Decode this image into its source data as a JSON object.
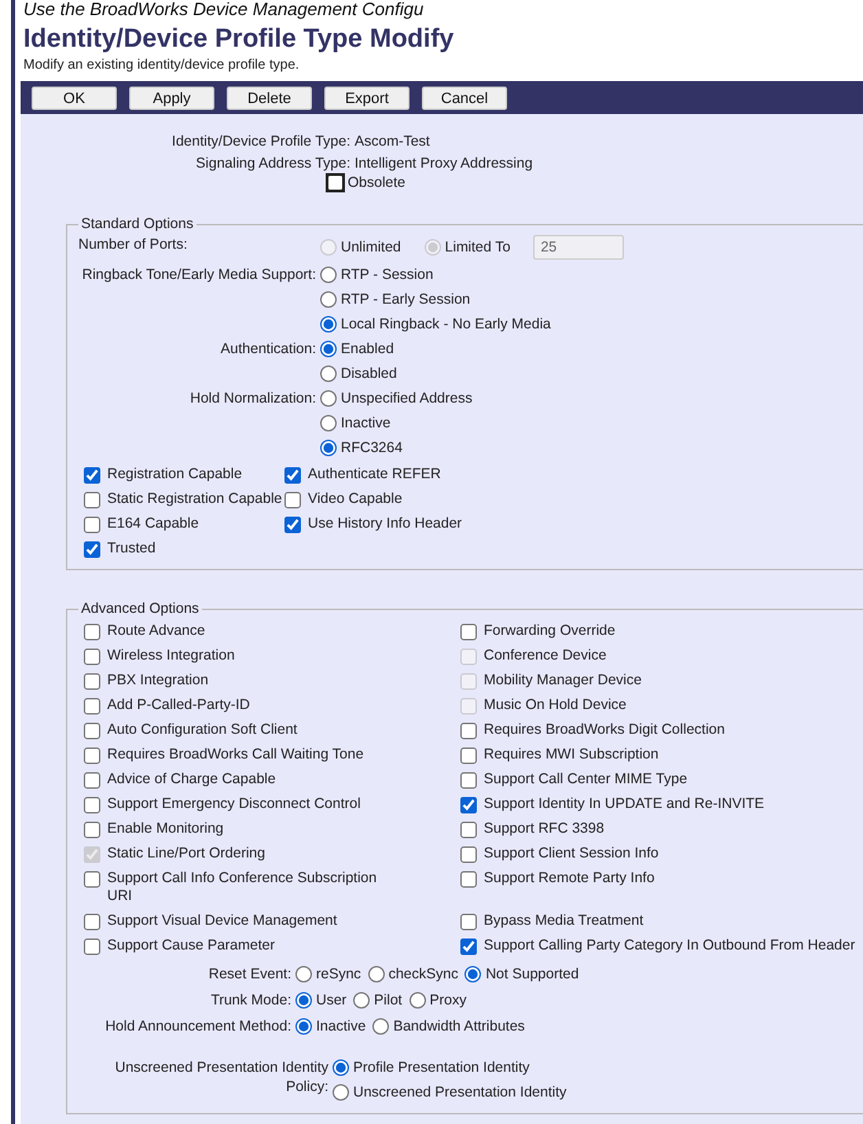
{
  "caption": "Use the BroadWorks Device Management Configu",
  "page": {
    "title": "Identity/Device Profile Type Modify",
    "subtitle": "Modify an existing identity/device profile type."
  },
  "buttons": [
    "OK",
    "Apply",
    "Delete",
    "Export",
    "Cancel"
  ],
  "info": [
    {
      "label": "Identity/Device Profile Type:",
      "value": "Ascom-Test"
    },
    {
      "label": "Signaling Address Type:",
      "value": "Intelligent Proxy Addressing"
    }
  ],
  "obsolete": {
    "label": "Obsolete",
    "checked": false
  },
  "standard_options": {
    "title": "Standard Options",
    "ports": {
      "label": "Number of Ports:",
      "options": [
        {
          "label": "Unlimited",
          "selected": false,
          "disabled": true
        },
        {
          "label": "Limited To",
          "selected": true,
          "disabled": true
        }
      ],
      "value": "25"
    },
    "radio_groups": [
      {
        "label": "Ringback Tone/Early Media Support:",
        "options": [
          {
            "label": "RTP - Session",
            "selected": false
          },
          {
            "label": "RTP - Early Session",
            "selected": false
          },
          {
            "label": "Local Ringback - No Early Media",
            "selected": true
          }
        ]
      },
      {
        "label": "Authentication:",
        "options": [
          {
            "label": "Enabled",
            "selected": true
          },
          {
            "label": "Disabled",
            "selected": false
          }
        ]
      },
      {
        "label": "Hold Normalization:",
        "options": [
          {
            "label": "Unspecified Address",
            "selected": false
          },
          {
            "label": "Inactive",
            "selected": false
          },
          {
            "label": "RFC3264",
            "selected": true
          }
        ]
      }
    ],
    "checkboxes": [
      {
        "label": "Registration Capable",
        "checked": true
      },
      {
        "label": "Authenticate REFER",
        "checked": true
      },
      {
        "label": "Static Registration Capable",
        "checked": false
      },
      {
        "label": "Video Capable",
        "checked": false
      },
      {
        "label": "E164 Capable",
        "checked": false
      },
      {
        "label": "Use History Info Header",
        "checked": true
      },
      {
        "label": "Trusted",
        "checked": true
      }
    ]
  },
  "advanced_options": {
    "title": "Advanced Options",
    "checkboxes": [
      {
        "label": "Route Advance",
        "checked": false,
        "disabled": false
      },
      {
        "label": "Forwarding Override",
        "checked": false,
        "disabled": false
      },
      {
        "label": "Wireless Integration",
        "checked": false,
        "disabled": false
      },
      {
        "label": "Conference Device",
        "checked": false,
        "disabled": true
      },
      {
        "label": "PBX Integration",
        "checked": false,
        "disabled": false
      },
      {
        "label": "Mobility Manager Device",
        "checked": false,
        "disabled": true
      },
      {
        "label": "Add P-Called-Party-ID",
        "checked": false,
        "disabled": false
      },
      {
        "label": "Music On Hold Device",
        "checked": false,
        "disabled": true
      },
      {
        "label": "Auto Configuration Soft Client",
        "checked": false,
        "disabled": false
      },
      {
        "label": "Requires BroadWorks Digit Collection",
        "checked": false,
        "disabled": false
      },
      {
        "label": "Requires BroadWorks Call Waiting Tone",
        "checked": false,
        "disabled": false
      },
      {
        "label": "Requires MWI Subscription",
        "checked": false,
        "disabled": false
      },
      {
        "label": "Advice of Charge Capable",
        "checked": false,
        "disabled": false
      },
      {
        "label": "Support Call Center MIME Type",
        "checked": false,
        "disabled": false
      },
      {
        "label": "Support Emergency Disconnect Control",
        "checked": false,
        "disabled": false
      },
      {
        "label": "Support Identity In UPDATE and Re-INVITE",
        "checked": true,
        "disabled": false
      },
      {
        "label": "Enable Monitoring",
        "checked": false,
        "disabled": false
      },
      {
        "label": "Support RFC 3398",
        "checked": false,
        "disabled": false
      },
      {
        "label": "Static Line/Port Ordering",
        "checked": true,
        "disabled": true
      },
      {
        "label": "Support Client Session Info",
        "checked": false,
        "disabled": false
      },
      {
        "label": "Support Call Info Conference Subscription URI",
        "checked": false,
        "disabled": false
      },
      {
        "label": "Support Remote Party Info",
        "checked": false,
        "disabled": false
      },
      {
        "label": "Support Visual Device Management",
        "checked": false,
        "disabled": false
      },
      {
        "label": "Bypass Media Treatment",
        "checked": false,
        "disabled": false
      },
      {
        "label": "Support Cause Parameter",
        "checked": false,
        "disabled": false
      },
      {
        "label": "Support Calling Party Category In Outbound From Header",
        "checked": true,
        "disabled": false
      }
    ],
    "inline_groups": [
      {
        "label": "Reset Event:",
        "options": [
          {
            "label": "reSync",
            "selected": false
          },
          {
            "label": "checkSync",
            "selected": false
          },
          {
            "label": "Not Supported",
            "selected": true
          }
        ]
      },
      {
        "label": "Trunk Mode:",
        "options": [
          {
            "label": "User",
            "selected": true
          },
          {
            "label": "Pilot",
            "selected": false
          },
          {
            "label": "Proxy",
            "selected": false
          }
        ]
      },
      {
        "label": "Hold Announcement Method:",
        "options": [
          {
            "label": "Inactive",
            "selected": true
          },
          {
            "label": "Bandwidth Attributes",
            "selected": false
          }
        ]
      }
    ],
    "policy": {
      "label": "Unscreened Presentation Identity Policy:",
      "options": [
        {
          "label": "Profile Presentation Identity",
          "selected": true
        },
        {
          "label": "Unscreened Presentation Identity",
          "selected": false
        }
      ]
    }
  }
}
